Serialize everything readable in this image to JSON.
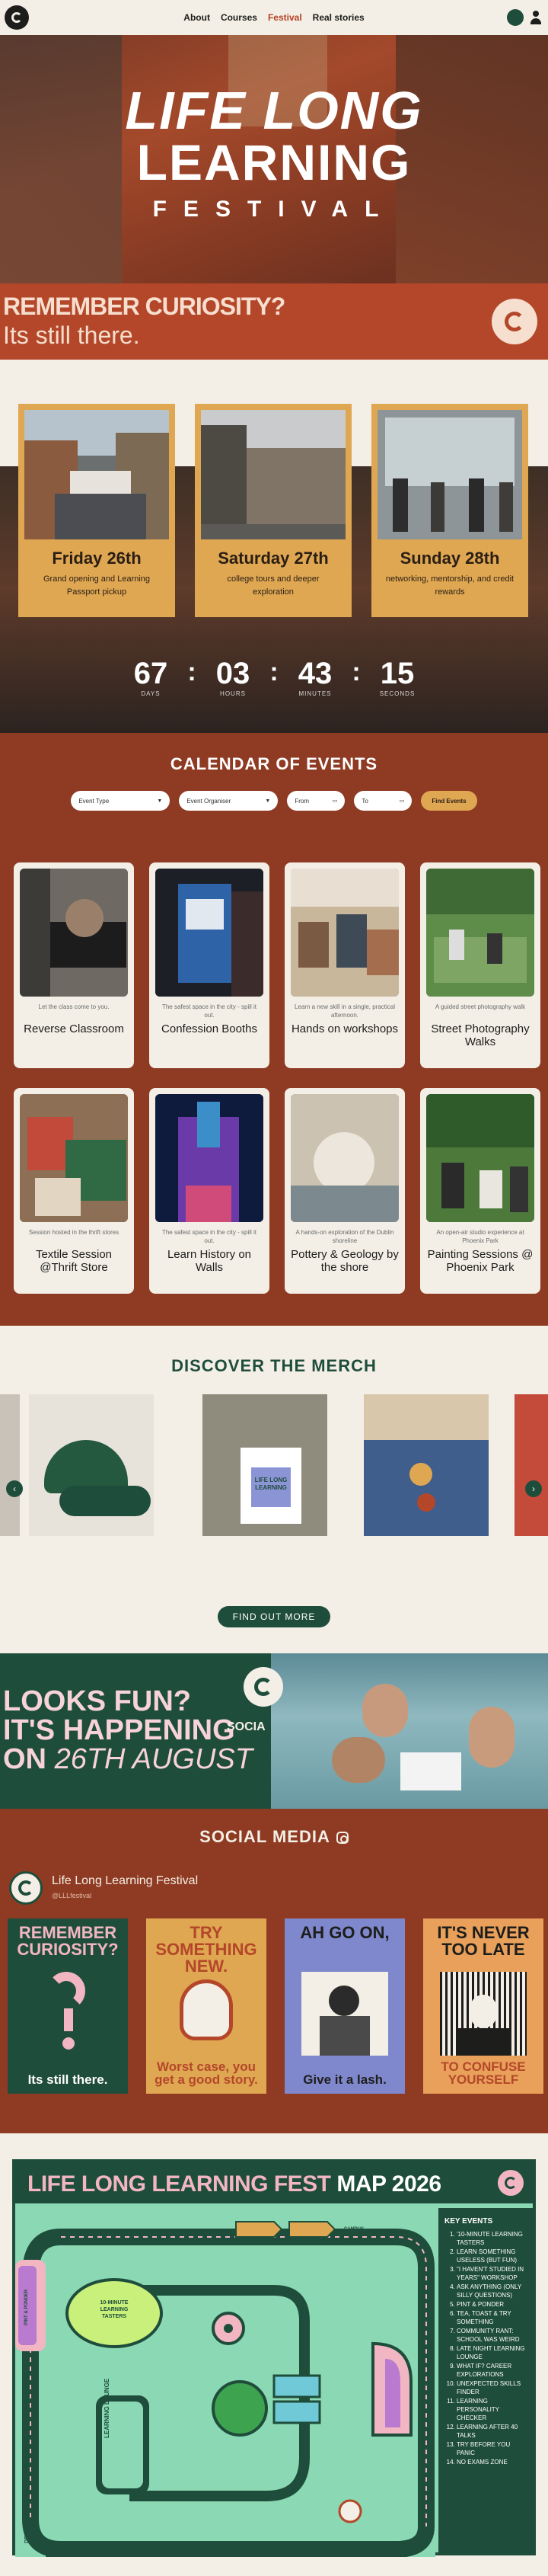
{
  "nav": {
    "links": [
      "About",
      "Courses",
      "Festival",
      "Real stories"
    ],
    "active": "Festival"
  },
  "hero": {
    "line1": "LIFE LONG",
    "line2": "LEARNING",
    "line3": "FESTIVAL"
  },
  "curiosity": {
    "question": "REMEMBER CURIOSITY?",
    "subtitle": "Its still there."
  },
  "days": [
    {
      "title": "Friday 26th",
      "desc": "Grand opening and Learning Passport pickup"
    },
    {
      "title": "Saturday 27th",
      "desc": "college tours and deeper exploration"
    },
    {
      "title": "Sunday 28th",
      "desc": "networking, mentorship, and credit rewards"
    }
  ],
  "countdown": {
    "days": "67",
    "hours": "03",
    "minutes": "43",
    "seconds": "15",
    "days_label": "DAYS",
    "hours_label": "HOURS",
    "minutes_label": "MINUTES",
    "seconds_label": "SECONDS"
  },
  "calendar": {
    "title": "CALENDAR OF EVENTS",
    "filters": {
      "type": "Event Type",
      "organiser": "Event Organiser",
      "from": "From",
      "to": "To",
      "button": "Find Events"
    },
    "events": [
      {
        "small": "Let the class come to you.",
        "title": "Reverse Classroom"
      },
      {
        "small": "The safest space in the city - spill it out.",
        "title": "Confession Booths"
      },
      {
        "small": "Learn a new skill in a single, practical afternoon.",
        "title": "Hands on workshops"
      },
      {
        "small": "A guided street photography walk",
        "title": "Street Photography Walks"
      },
      {
        "small": "Session hosted in the thrift stores",
        "title": "Textile Session @Thrift Store"
      },
      {
        "small": "The safest space in the city - spill it out.",
        "title": "Learn History on Walls"
      },
      {
        "small": "A hands-on exploration of the Dublin shoreline",
        "title": "Pottery & Geology by the shore"
      },
      {
        "small": "An open-air studio experience at Phoenix Park",
        "title": "Painting Sessions @ Phoenix Park"
      }
    ]
  },
  "merch": {
    "title": "DISCOVER THE MERCH",
    "button": "FIND OUT MORE",
    "bag_text": "LIFE LONG LEARNING"
  },
  "social_banner": {
    "line1": "LOOKS FUN?",
    "line2": "IT'S HAPPENING",
    "line3a": "ON ",
    "line3b": "26TH AUGUST",
    "overlay": "SOCIA"
  },
  "social": {
    "title": "SOCIAL MEDIA",
    "profile_name": "Life Long Learning Festival",
    "profile_handle": "@LLLfestival",
    "posts": [
      {
        "head": "REMEMBER CURIOSITY?",
        "foot": "Its still there.",
        "bg": "#1f4d3b",
        "fg": "#f2b6c3",
        "foot_fg": "#ffffff"
      },
      {
        "head": "TRY SOMETHING NEW.",
        "foot": "Worst case, you get a good story.",
        "bg": "#dfa752",
        "fg": "#b4472a",
        "foot_fg": "#b4472a"
      },
      {
        "head": "AH GO ON,",
        "foot": "Give it a lash.",
        "bg": "#7f88cc",
        "fg": "#1d1d1b",
        "foot_fg": "#1d1d1b"
      },
      {
        "head": "IT'S NEVER TOO LATE",
        "foot": "TO CONFUSE YOURSELF",
        "bg": "#e8a05a",
        "fg": "#1d1d1b",
        "foot_fg": "#b4472a"
      }
    ]
  },
  "map": {
    "title_a": "LIFE LONG LEARNING FEST ",
    "title_b": "MAP 2026",
    "key_title": "KEY EVENTS",
    "key_events": [
      "'10-MINUTE LEARNING TASTERS",
      "LEARN SOMETHING USELESS (BUT FUN)",
      "\"I HAVEN'T STUDIED IN YEARS\" WORKSHOP",
      "ASK ANYTHING (ONLY SILLY QUESTIONS)",
      "PINT & PONDER",
      "TEA, TOAST & TRY SOMETHING",
      "COMMUNITY RANT: SCHOOL WAS WEIRD",
      "LATE NIGHT LEARNING LOUNGE",
      "WHAT IF? CAREER EXPLORATIONS",
      "UNEXPECTED SKILLS FINDER",
      "LEARNING PERSONALITY CHECKER",
      "LEARNING AFTER 40 TALKS",
      "TRY BEFORE YOU PANIC",
      "NO EXAMS ZONE"
    ],
    "labels": {
      "tasters": "10-MINUTE LEARNING TASTERS",
      "lounge": "LATE NIGHT LEARNING LOUNGE",
      "campus": "CAMPUS WALKTHROUGH TOURS",
      "side_left": "PINT & PONDER",
      "side_bottom": "DESK CLASSROOMS"
    }
  },
  "colors": {
    "brand_green": "#1f4d3b",
    "brand_rust": "#8f3a22",
    "brand_mustard": "#dfa752",
    "brand_pink": "#f2b6c3",
    "cream": "#f3efe6"
  }
}
